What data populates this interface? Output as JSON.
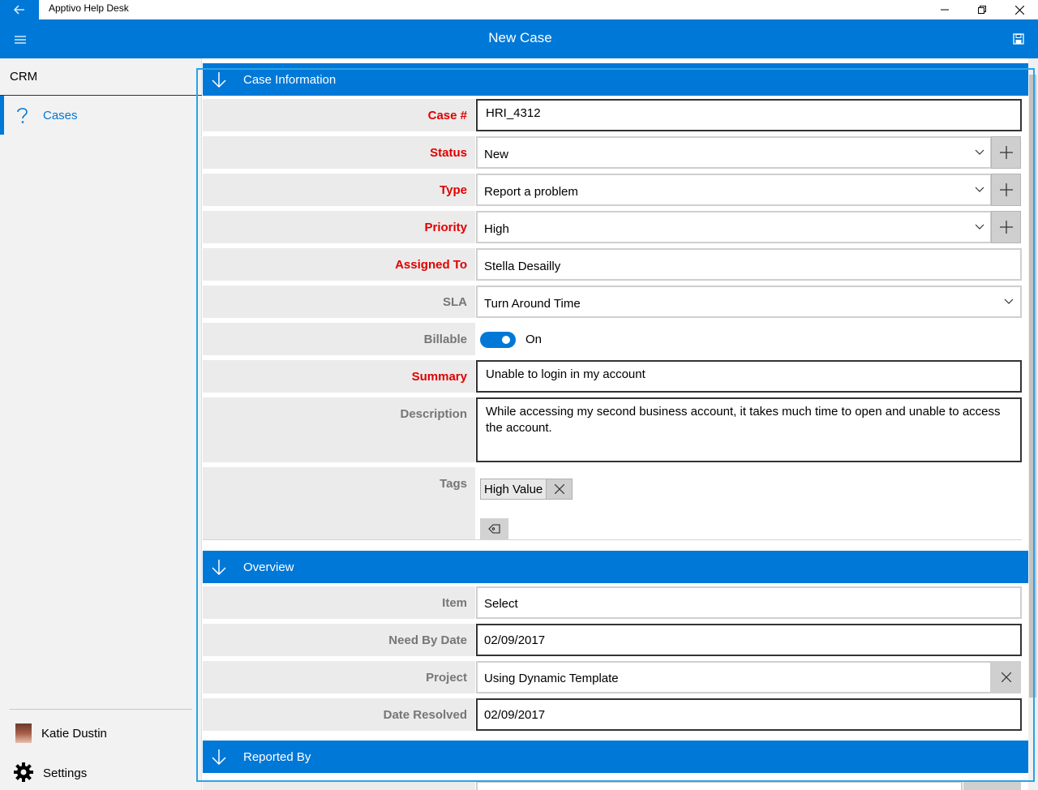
{
  "window": {
    "app_title": "Apptivo Help Desk"
  },
  "header": {
    "title": "New Case"
  },
  "sidebar": {
    "section": "CRM",
    "items": [
      {
        "label": "Cases"
      }
    ],
    "user": {
      "name": "Katie Dustin"
    },
    "settings_label": "Settings"
  },
  "sections": {
    "case_information": "Case Information",
    "overview": "Overview",
    "reported_by": "Reported By"
  },
  "case": {
    "case_no_label": "Case #",
    "case_no": "HRI_4312",
    "status_label": "Status",
    "status": "New",
    "type_label": "Type",
    "type": "Report a problem",
    "priority_label": "Priority",
    "priority": "High",
    "assigned_label": "Assigned To",
    "assigned": "Stella Desailly",
    "sla_label": "SLA",
    "sla": "Turn Around Time",
    "billable_label": "Billable",
    "billable": "On",
    "summary_label": "Summary",
    "summary": "Unable to login in my account",
    "description_label": "Description",
    "description": "While accessing my second business account, it takes much time to open and unable to access the account.",
    "tags_label": "Tags",
    "tags": [
      "High Value"
    ]
  },
  "overview": {
    "item_label": "Item",
    "item": "Select",
    "need_by_label": "Need By Date",
    "need_by": "02/09/2017",
    "project_label": "Project",
    "project": "Using Dynamic Template",
    "resolved_label": "Date Resolved",
    "resolved": "02/09/2017"
  },
  "colors": {
    "accent": "#0078d7",
    "required": "#e00000",
    "label_grey": "#767676",
    "focus": "#29a3e8"
  },
  "icons": {
    "back": "arrow-left-icon",
    "hamburger": "hamburger-icon",
    "save": "save-icon",
    "cases": "question-mark-icon",
    "settings": "gear-icon",
    "section_toggle": "arrow-down-icon",
    "add": "plus-icon",
    "dropdown": "chevron-down-icon",
    "remove": "close-icon",
    "tag_add": "tag-icon"
  }
}
